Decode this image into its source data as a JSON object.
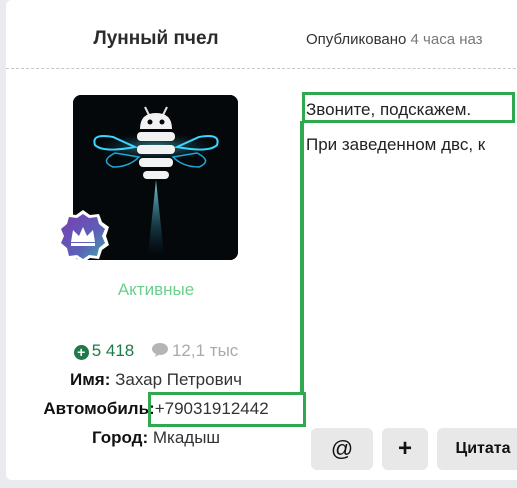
{
  "post": {
    "author_name": "Лунный пчел",
    "published_label": "Опубликовано",
    "published_time": "4 часа наз",
    "status": "Активные",
    "rating": "5 418",
    "comments_count": "12,1 тыс",
    "name_label": "Имя:",
    "name_value": "Захар Петрович",
    "car_label": "Автомобиль:",
    "car_value": "+79031912442",
    "city_label": "Город:",
    "city_value": "Мкадыш",
    "message_line1": "Звоните, подскажем.",
    "message_line2": "При заведенном двс, к"
  },
  "toolbar": {
    "mention_label": "@",
    "add_label": "+",
    "quote_label": "Цитата"
  },
  "colors": {
    "highlight": "#2fa84f",
    "status": "#6ccf8c",
    "rating": "#1f7a4a",
    "badge": "#6a4aa8"
  }
}
